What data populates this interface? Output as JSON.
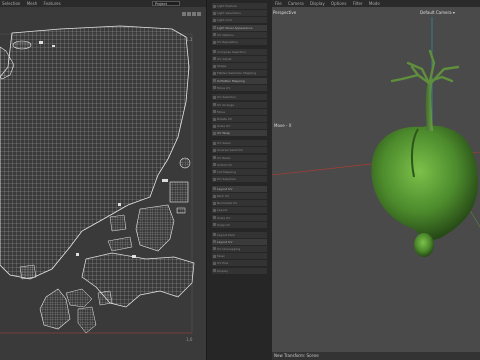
{
  "uv_editor": {
    "menu": [
      "Selection",
      "Mesh",
      "Features"
    ],
    "projection_select": "Project",
    "corner_label_top": "1,1",
    "corner_label_bottom": "1,0"
  },
  "tool_panel": {
    "items": [
      "Light Feature",
      "Light Selections",
      "Light Grid",
      "Light Panel Appearance",
      "UV Options",
      "UV Reposition",
      "Compose Selection",
      "UV Adjust",
      "Shape",
      "Flatten Selection Mapping",
      "Unflatten Mapping",
      "Move UV",
      "UV Selection",
      "UV Arrange",
      "Move",
      "Rotate UV",
      "Scale UV",
      "UV Wrap",
      "UV Seam",
      "Unwrap Selection",
      "UV Relax",
      "Unfold UV",
      "Cut Mapping",
      "Pin Selection",
      "Layout UV",
      "Pack UV",
      "Normalize UV",
      "Layout",
      "Scale UV",
      "Snap UV",
      "Layout Pack",
      "Layout UV",
      "UV Unwrapping",
      "Texel",
      "UV Pins",
      "Display"
    ]
  },
  "viewport": {
    "menu": [
      "File",
      "Camera",
      "Display",
      "Options",
      "Filter",
      "Mode"
    ],
    "view_label": "Perspective",
    "camera_label": "Default Camera ▾",
    "axis_label": "Move - X",
    "status": "New Transform: Scene"
  },
  "colors": {
    "uv_background": "#3a3a3a",
    "uv_wire": "#d9d9d9",
    "viewport_background": "#4a4a4a",
    "fruit_green": "#4c8a2c",
    "axis_red": "#c0392b"
  }
}
